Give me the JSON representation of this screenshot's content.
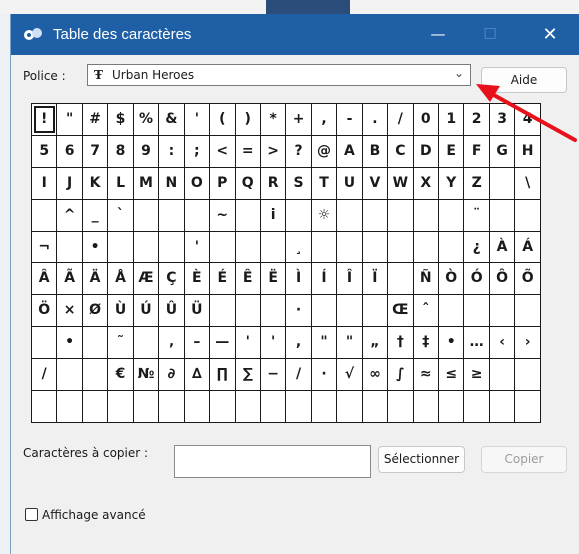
{
  "window": {
    "title": "Table des caractères"
  },
  "titlebar": {
    "minimize": "—",
    "maximize": "☐",
    "close": "✕"
  },
  "font": {
    "label": "Police :",
    "tt_badge": "Ŧ",
    "value": "Urban Heroes",
    "chevron": "⌄"
  },
  "buttons": {
    "help": "Aide",
    "select": "Sélectionner",
    "copy": "Copier"
  },
  "copy_field": {
    "label": "Caractères à copier :",
    "value": ""
  },
  "advanced": {
    "label": "Affichage avancé",
    "checked": false
  },
  "arrow_color": "#e8101b",
  "selected_cell": 0,
  "grid": [
    [
      "!",
      "\"",
      "#",
      "$",
      "%",
      "&",
      "'",
      "(",
      ")",
      "*",
      "+",
      ",",
      "-",
      ".",
      "/",
      "0",
      "1",
      "2",
      "3",
      "4"
    ],
    [
      "5",
      "6",
      "7",
      "8",
      "9",
      ":",
      ";",
      "<",
      "=",
      ">",
      "?",
      "@",
      "A",
      "B",
      "C",
      "D",
      "E",
      "F",
      "G",
      "H"
    ],
    [
      "I",
      "J",
      "K",
      "L",
      "M",
      "N",
      "O",
      "P",
      "Q",
      "R",
      "S",
      "T",
      "U",
      "V",
      "W",
      "X",
      "Y",
      "Z",
      "",
      "\\"
    ],
    [
      "",
      "^",
      "_",
      "`",
      "",
      "",
      "",
      "~",
      "",
      "i",
      "",
      "☼",
      "",
      "",
      "",
      "",
      "",
      "¨",
      "",
      ""
    ],
    [
      "¬",
      "",
      "•",
      "",
      "",
      "",
      "'",
      "",
      "",
      "",
      "¸",
      "",
      "",
      "",
      "",
      "",
      "",
      "¿",
      "À",
      "Á"
    ],
    [
      "Â",
      "Ã",
      "Ä",
      "Å",
      "Æ",
      "Ç",
      "È",
      "É",
      "Ê",
      "Ë",
      "Ì",
      "Í",
      "Î",
      "Ï",
      "",
      "Ñ",
      "Ò",
      "Ó",
      "Ô",
      "Õ"
    ],
    [
      "Ö",
      "×",
      "Ø",
      "Ù",
      "Ú",
      "Û",
      "Ü",
      "",
      "",
      "",
      "·",
      "",
      "",
      "",
      "Œ",
      "ˆ",
      "",
      "",
      "",
      ""
    ],
    [
      "",
      "•",
      "",
      "˜",
      "",
      "‚",
      "–",
      "—",
      "'",
      "'",
      ",",
      "\"",
      "\"",
      "„",
      "†",
      "‡",
      "•",
      "…",
      "‹",
      "›"
    ],
    [
      "/",
      "",
      "",
      "€",
      "№",
      "∂",
      "∆",
      "∏",
      "∑",
      "−",
      "/",
      "·",
      "√",
      "∞",
      "∫",
      "≈",
      "≤",
      "≥",
      "",
      ""
    ],
    [
      "",
      "",
      "",
      "",
      "",
      "",
      "",
      "",
      "",
      "",
      "",
      "",
      "",
      "",
      "",
      "",
      "",
      "",
      "",
      ""
    ]
  ]
}
